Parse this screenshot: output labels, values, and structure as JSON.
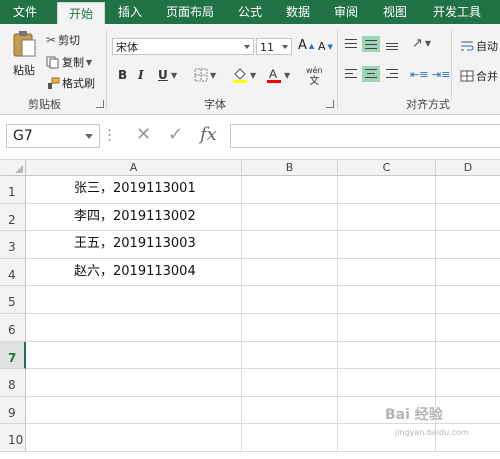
{
  "ribbon_tabs": [
    {
      "label": "文件"
    },
    {
      "label": "开始"
    },
    {
      "label": "插入"
    },
    {
      "label": "页面布局"
    },
    {
      "label": "公式"
    },
    {
      "label": "数据"
    },
    {
      "label": "审阅"
    },
    {
      "label": "视图"
    },
    {
      "label": "开发工具"
    }
  ],
  "clipboard": {
    "paste_label": "粘贴",
    "cut_label": "剪切",
    "copy_label": "复制",
    "format_painter_label": "格式刷",
    "group_label": "剪贴板"
  },
  "font": {
    "font_name": "宋体",
    "font_size": "11",
    "bold": "B",
    "italic": "I",
    "underline": "U",
    "grow": "A",
    "shrink": "A",
    "phonetic": "wén",
    "group_label": "字体",
    "highlight_color": "#ffff00",
    "font_color": "#ff0000"
  },
  "alignment": {
    "wrap_label": "自动",
    "merge_label": "合并",
    "group_label": "对齐方式"
  },
  "formula_bar": {
    "name_box": "G7",
    "cancel_glyph": "✕",
    "enter_glyph": "✓",
    "fx_label": "fx",
    "formula": ""
  },
  "columns": [
    "A",
    "B",
    "C",
    "D"
  ],
  "rows": [
    {
      "num": "1",
      "a": "张三，2019113001"
    },
    {
      "num": "2",
      "a": "李四，2019113002"
    },
    {
      "num": "3",
      "a": "王五，2019113003"
    },
    {
      "num": "4",
      "a": "赵六，2019113004"
    },
    {
      "num": "5",
      "a": ""
    },
    {
      "num": "6",
      "a": ""
    },
    {
      "num": "7",
      "a": ""
    },
    {
      "num": "8",
      "a": ""
    },
    {
      "num": "9",
      "a": ""
    },
    {
      "num": "10",
      "a": ""
    }
  ],
  "selected_row": "7",
  "watermark": {
    "text": "Bai 经验",
    "url": "jingyan.baidu.com"
  },
  "theme": {
    "accent": "#217346",
    "selection": "#9fd5b7"
  }
}
